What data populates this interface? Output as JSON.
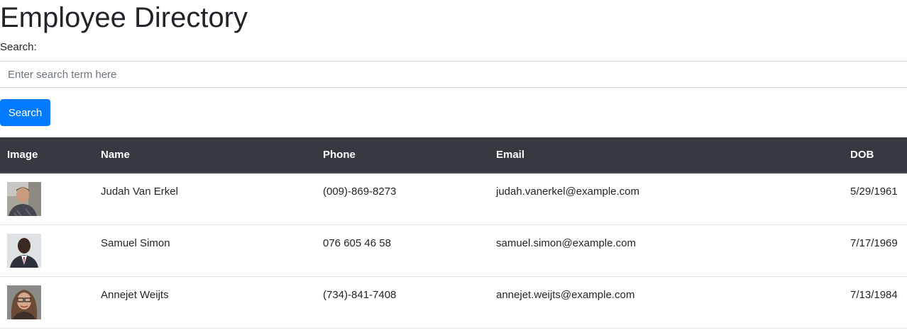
{
  "page": {
    "title": "Employee Directory"
  },
  "search": {
    "label": "Search:",
    "placeholder": "Enter search term here",
    "value": "",
    "button_label": "Search"
  },
  "table": {
    "headers": [
      "Image",
      "Name",
      "Phone",
      "Email",
      "DOB"
    ],
    "rows": [
      {
        "name": "Judah Van Erkel",
        "phone": "(009)-869-8273",
        "email": "judah.vanerkel@example.com",
        "dob": "5/29/1961",
        "avatar": "employee-photo-icon"
      },
      {
        "name": "Samuel Simon",
        "phone": "076 605 46 58",
        "email": "samuel.simon@example.com",
        "dob": "7/17/1969",
        "avatar": "employee-photo-icon"
      },
      {
        "name": "Annejet Weijts",
        "phone": "(734)-841-7408",
        "email": "annejet.weijts@example.com",
        "dob": "7/13/1984",
        "avatar": "employee-photo-icon"
      }
    ]
  },
  "colors": {
    "primary": "#007bff",
    "header_bg": "#343a40",
    "text": "#212529"
  }
}
